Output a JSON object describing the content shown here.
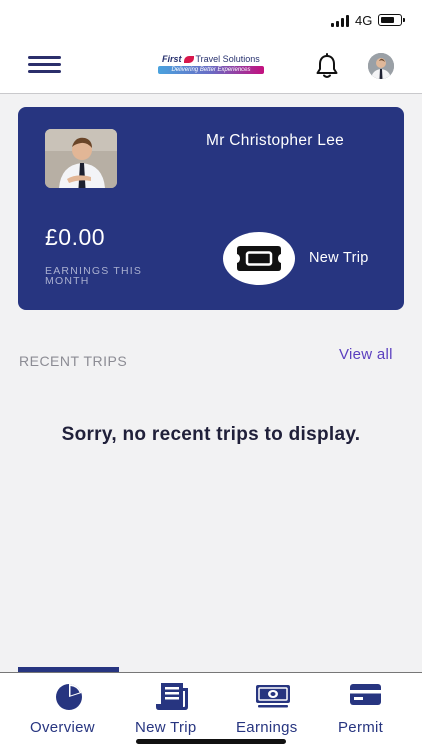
{
  "status_bar": {
    "network": "4G"
  },
  "header": {
    "logo_line1_brand": "First",
    "logo_line1_rest": "Travel Solutions",
    "logo_tagline": "Delivering Better Experiences"
  },
  "profile_card": {
    "name": "Mr Christopher Lee",
    "earnings_amount": "£0.00",
    "earnings_label": "EARNINGS THIS MONTH",
    "new_trip_label": "New Trip"
  },
  "recent_trips": {
    "title": "RECENT TRIPS",
    "view_all": "View all",
    "empty_message": "Sorry, no recent trips to display."
  },
  "bottom_nav": {
    "items": [
      {
        "label": "Overview",
        "icon": "pie-chart-icon"
      },
      {
        "label": "New Trip",
        "icon": "receipt-icon"
      },
      {
        "label": "Earnings",
        "icon": "banknote-icon"
      },
      {
        "label": "Permit",
        "icon": "card-icon"
      }
    ],
    "active": "Overview"
  },
  "colors": {
    "brand_navy": "#273580",
    "accent_purple": "#5b3fbf",
    "background": "#f2f2f3"
  }
}
